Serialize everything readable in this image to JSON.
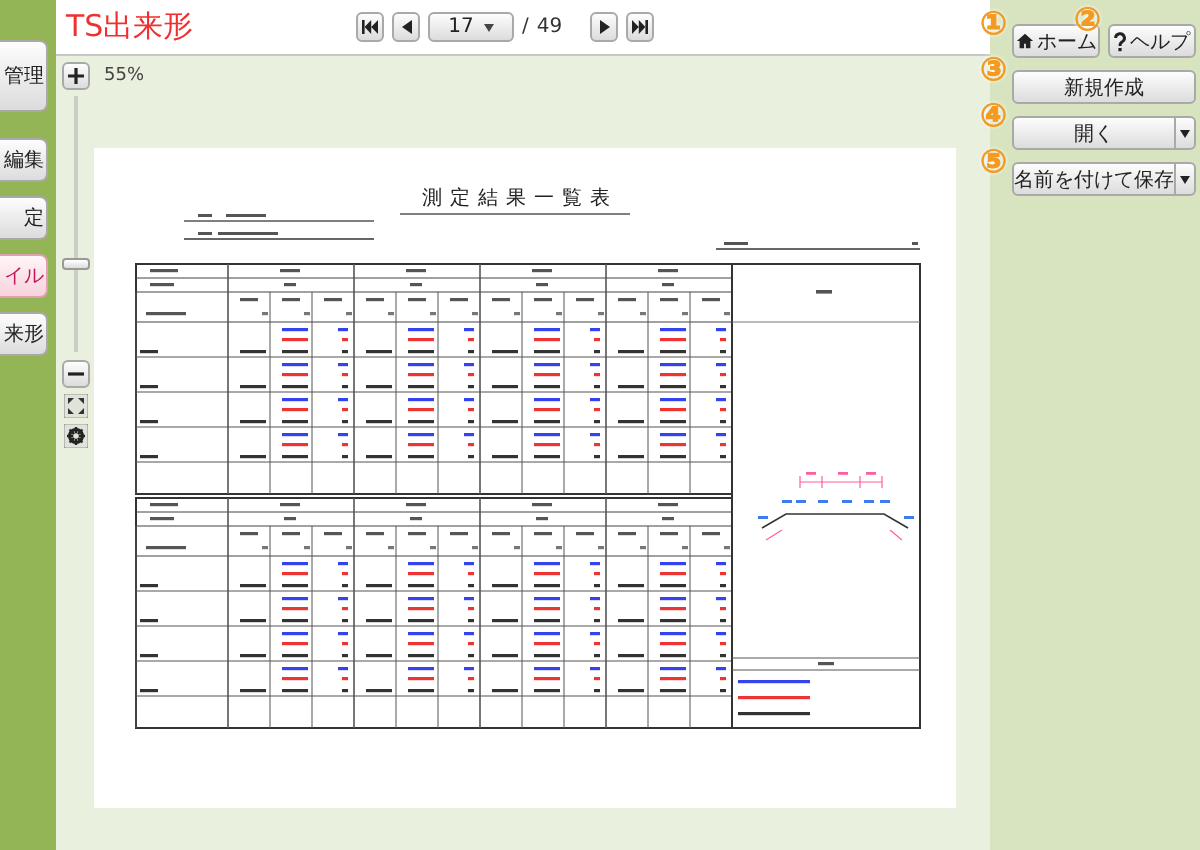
{
  "app_title": "TS出来形",
  "sidebar": {
    "items": [
      {
        "label": "管理",
        "selected": false,
        "tall": true
      },
      {
        "label": "編集",
        "selected": false,
        "tall": false
      },
      {
        "label": "定",
        "selected": false,
        "tall": false
      },
      {
        "label": "イル",
        "selected": true,
        "tall": false
      },
      {
        "label": "来形",
        "selected": false,
        "tall": false
      }
    ]
  },
  "pager": {
    "page": "17",
    "separator": "/",
    "total": "49"
  },
  "zoom": {
    "label": "55%",
    "level": 0.34
  },
  "document": {
    "title": "測定結果一覧表"
  },
  "actions": [
    {
      "marker": "①",
      "label": "ホーム",
      "kind": "home"
    },
    {
      "marker": "②",
      "label": "ヘルプ",
      "kind": "help"
    },
    {
      "marker": "③",
      "label": "新規作成",
      "kind": "plain"
    },
    {
      "marker": "④",
      "label": "開く",
      "kind": "split"
    },
    {
      "marker": "⑤",
      "label": "名前を付けて保存",
      "kind": "split"
    }
  ]
}
